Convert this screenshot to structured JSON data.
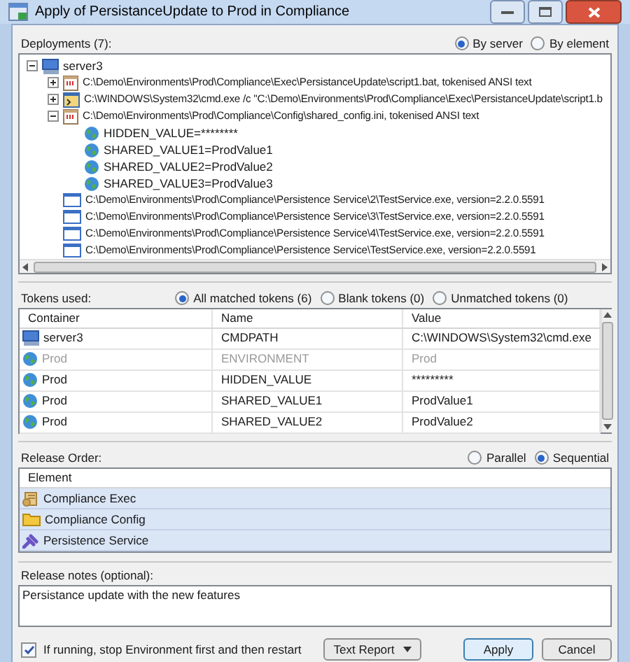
{
  "window": {
    "title": "Apply of PersistanceUpdate to Prod in Compliance"
  },
  "deployments": {
    "label": "Deployments (7):",
    "view_options": [
      {
        "label": "By server",
        "selected": true
      },
      {
        "label": "By element",
        "selected": false
      }
    ],
    "tree": [
      {
        "label": "server3",
        "kind": "server",
        "expanded": true,
        "children": [
          {
            "label": "C:\\Demo\\Environments\\Prod\\Compliance\\Exec\\PersistanceUpdate\\script1.bat, tokenised ANSI text",
            "kind": "script",
            "expanded": false
          },
          {
            "label": "C:\\WINDOWS\\System32\\cmd.exe /c \"C:\\Demo\\Environments\\Prod\\Compliance\\Exec\\PersistanceUpdate\\script1.b",
            "kind": "command",
            "expanded": false
          },
          {
            "label": "C:\\Demo\\Environments\\Prod\\Compliance\\Config\\shared_config.ini, tokenised ANSI text",
            "kind": "script",
            "expanded": true,
            "children": [
              {
                "label": "HIDDEN_VALUE=********",
                "kind": "token"
              },
              {
                "label": "SHARED_VALUE1=ProdValue1",
                "kind": "token"
              },
              {
                "label": "SHARED_VALUE2=ProdValue2",
                "kind": "token"
              },
              {
                "label": "SHARED_VALUE3=ProdValue3",
                "kind": "token"
              }
            ]
          },
          {
            "label": "C:\\Demo\\Environments\\Prod\\Compliance\\Persistence Service\\2\\TestService.exe, version=2.2.0.5591",
            "kind": "service"
          },
          {
            "label": "C:\\Demo\\Environments\\Prod\\Compliance\\Persistence Service\\3\\TestService.exe, version=2.2.0.5591",
            "kind": "service"
          },
          {
            "label": "C:\\Demo\\Environments\\Prod\\Compliance\\Persistence Service\\4\\TestService.exe, version=2.2.0.5591",
            "kind": "service"
          },
          {
            "label": "C:\\Demo\\Environments\\Prod\\Compliance\\Persistence Service\\TestService.exe, version=2.2.0.5591",
            "kind": "service"
          }
        ]
      }
    ]
  },
  "tokens": {
    "label": "Tokens used:",
    "filter_options": [
      {
        "label": "All matched tokens (6)",
        "selected": true
      },
      {
        "label": "Blank tokens (0)",
        "selected": false
      },
      {
        "label": "Unmatched tokens (0)",
        "selected": false
      }
    ],
    "columns": [
      "Container",
      "Name",
      "Value"
    ],
    "rows": [
      {
        "container": "server3",
        "kind": "server",
        "name": "CMDPATH",
        "value": "C:\\WINDOWS\\System32\\cmd.exe",
        "disabled": false
      },
      {
        "container": "Prod",
        "kind": "environment",
        "name": "ENVIRONMENT",
        "value": "Prod",
        "disabled": true
      },
      {
        "container": "Prod",
        "kind": "environment",
        "name": "HIDDEN_VALUE",
        "value": "*********",
        "disabled": false
      },
      {
        "container": "Prod",
        "kind": "environment",
        "name": "SHARED_VALUE1",
        "value": "ProdValue1",
        "disabled": false
      },
      {
        "container": "Prod",
        "kind": "environment",
        "name": "SHARED_VALUE2",
        "value": "ProdValue2",
        "disabled": false
      }
    ]
  },
  "release_order": {
    "label": "Release Order:",
    "options": [
      {
        "label": "Parallel",
        "selected": false
      },
      {
        "label": "Sequential",
        "selected": true
      }
    ],
    "column": "Element",
    "items": [
      {
        "label": "Compliance Exec",
        "kind": "exec"
      },
      {
        "label": "Compliance Config",
        "kind": "config"
      },
      {
        "label": "Persistence Service",
        "kind": "service"
      }
    ]
  },
  "release_notes": {
    "label": "Release notes (optional):",
    "value": "Persistance update with the new features"
  },
  "footer": {
    "restart_option": {
      "label": "If running, stop Environment first and then restart",
      "checked": true
    },
    "report_button": "Text Report",
    "buttons": [
      "Apply",
      "Cancel"
    ]
  }
}
